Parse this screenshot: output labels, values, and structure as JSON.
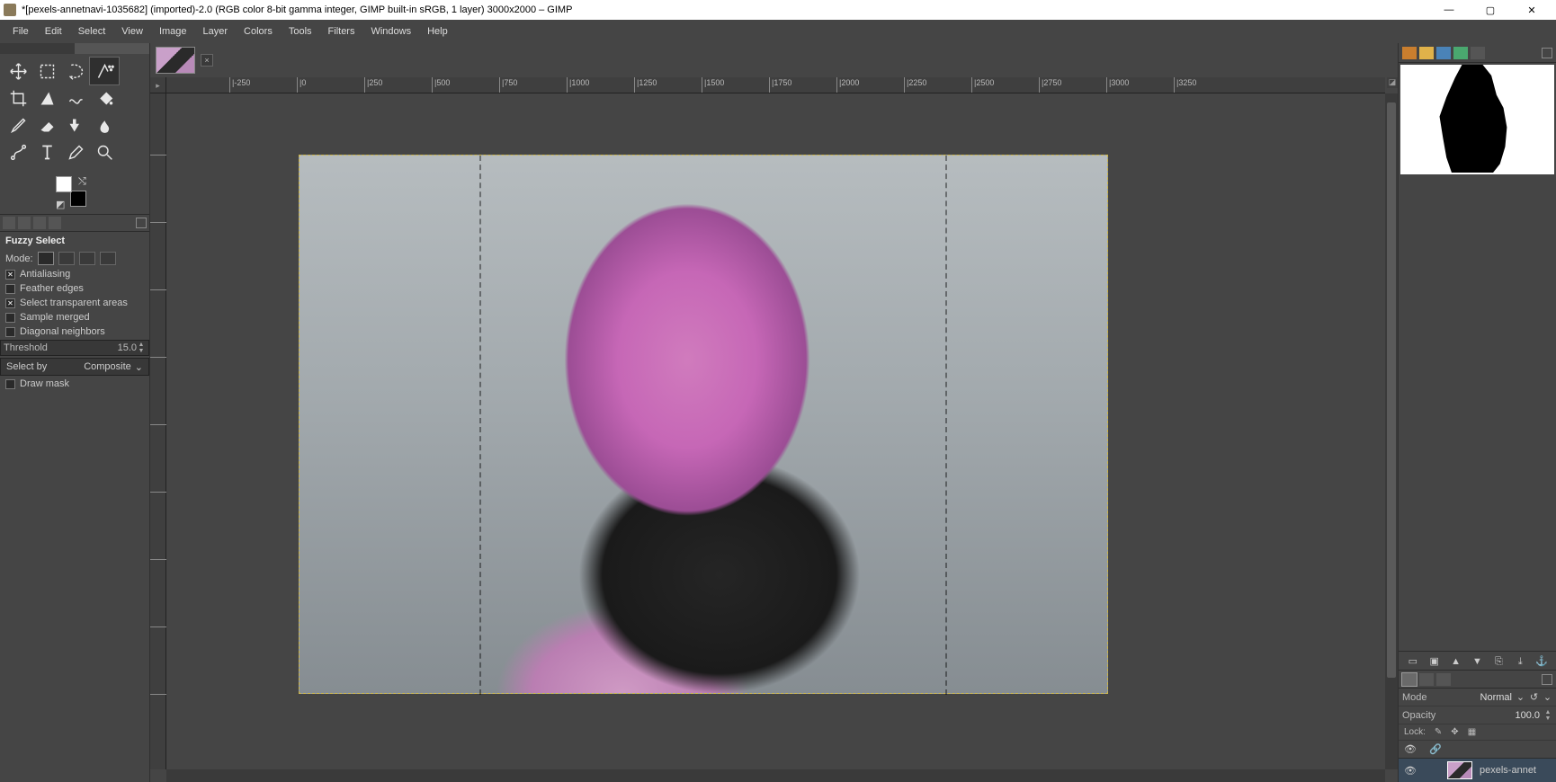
{
  "title": "*[pexels-annetnavi-1035682] (imported)-2.0 (RGB color 8-bit gamma integer, GIMP built-in sRGB, 1 layer) 3000x2000 – GIMP",
  "menu": [
    "File",
    "Edit",
    "Select",
    "View",
    "Image",
    "Layer",
    "Colors",
    "Tools",
    "Filters",
    "Windows",
    "Help"
  ],
  "toolOptions": {
    "title": "Fuzzy Select",
    "modeLabel": "Mode:",
    "antialias": "Antialiasing",
    "feather": "Feather edges",
    "transparent": "Select transparent areas",
    "sampleMerged": "Sample merged",
    "diagonal": "Diagonal neighbors",
    "thresholdLabel": "Threshold",
    "thresholdValue": "15.0",
    "selectByLabel": "Select by",
    "selectByValue": "Composite",
    "drawMask": "Draw mask"
  },
  "rulerH": [
    "|-250",
    "|0",
    "|250",
    "|500",
    "|750",
    "|1000",
    "|1250",
    "|1500",
    "|1750",
    "|2000",
    "|2250",
    "|2500",
    "|2750",
    "|3000",
    "|3250"
  ],
  "layers": {
    "modeLabel": "Mode",
    "modeValue": "Normal",
    "opacityLabel": "Opacity",
    "opacityValue": "100.0",
    "lockLabel": "Lock:",
    "layerName": "pexels-annet"
  }
}
